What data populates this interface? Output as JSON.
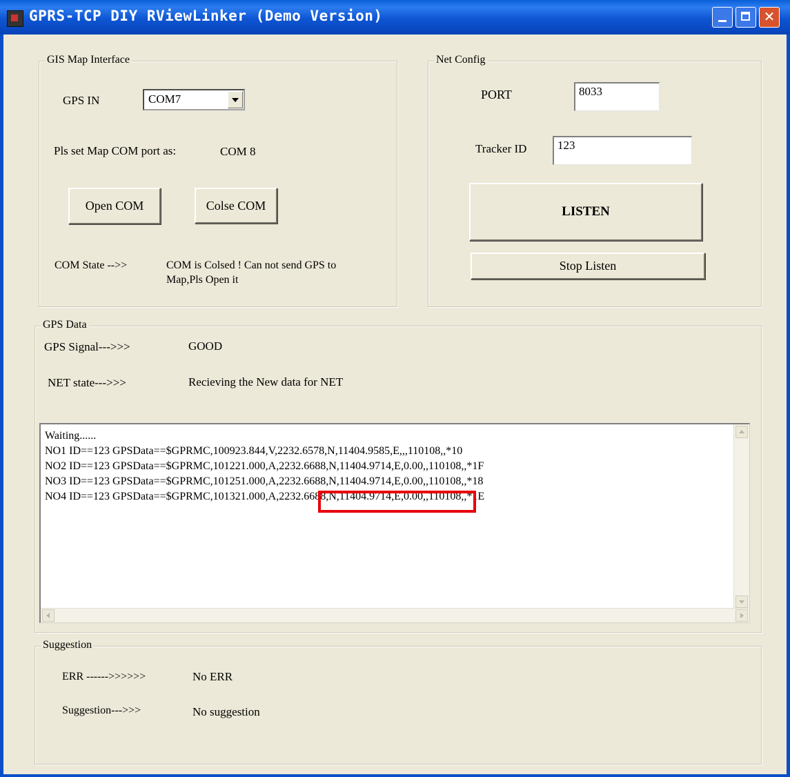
{
  "window": {
    "title": "GPRS-TCP DIY RViewLinker (Demo Version)",
    "close_glyph": "✕"
  },
  "gis_map": {
    "legend": "GIS Map Interface",
    "gps_in_label": "GPS IN",
    "gps_in_value": "COM7",
    "map_com_label": "Pls set Map COM port as:",
    "map_com_value": "COM 8",
    "open_com_label": "Open COM",
    "close_com_label": "Colse COM",
    "com_state_label": "COM State -->>",
    "com_state_line1": "COM is Colsed ! Can not send GPS to",
    "com_state_line2": "Map,Pls Open it"
  },
  "net_config": {
    "legend": "Net Config",
    "port_label": "PORT",
    "port_value": "8033",
    "tracker_label": "Tracker ID",
    "tracker_value": "123",
    "listen_label": "LISTEN",
    "stop_listen_label": "Stop Listen"
  },
  "gps_data": {
    "legend": "GPS Data",
    "signal_label": "GPS Signal--->>>",
    "signal_value": "GOOD",
    "net_state_label": "NET state--->>>",
    "net_state_value": "Recieving the New data for NET",
    "log_lines": [
      "Waiting......",
      "NO1  ID==123  GPSData==$GPRMC,100923.844,V,2232.6578,N,11404.9585,E,,,110108,,*10",
      "NO2  ID==123  GPSData==$GPRMC,101221.000,A,2232.6688,N,11404.9714,E,0.00,,110108,,*1F",
      "NO3  ID==123  GPSData==$GPRMC,101251.000,A,2232.6688,N,11404.9714,E,0.00,,110108,,*18",
      "NO4  ID==123  GPSData==$GPRMC,101321.000,A,2232.6688,N,11404.9714,E,0.00,,110108,,*1E"
    ],
    "highlight_color": "#e8000b"
  },
  "suggestion": {
    "legend": "Suggestion",
    "err_label": "ERR ------>>>>>>",
    "err_value": "No ERR",
    "suggestion_label": "Suggestion--->>>",
    "suggestion_value": "No suggestion"
  }
}
